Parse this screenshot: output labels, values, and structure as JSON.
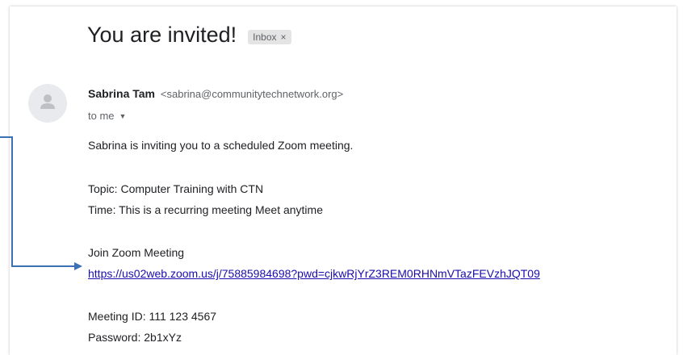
{
  "email": {
    "subject": "You are invited!",
    "label": "Inbox",
    "label_close": "×",
    "sender_name": "Sabrina Tam",
    "sender_email": "<sabrina@communitytechnetwork.org>",
    "recipient": "to me",
    "intro": "Sabrina is inviting you to a scheduled Zoom meeting.",
    "topic": "Topic: Computer Training with CTN",
    "time": "Time: This is a recurring meeting Meet anytime",
    "join_heading": "Join Zoom Meeting",
    "join_link": "https://us02web.zoom.us/j/75885984698?pwd=cjkwRjYrZ3REM0RHNmVTazFEVzhJQT09",
    "meeting_id": "Meeting ID: 111 123 4567",
    "password": "Password: 2b1xYz"
  },
  "icons": {
    "avatar": "person-icon",
    "recipient_dropdown": "caret-down-icon",
    "annotation": "arrow-icon"
  },
  "colors": {
    "link": "#1a0dab",
    "arrow": "#3b6fb6",
    "chip_bg": "#e4e4e4"
  }
}
